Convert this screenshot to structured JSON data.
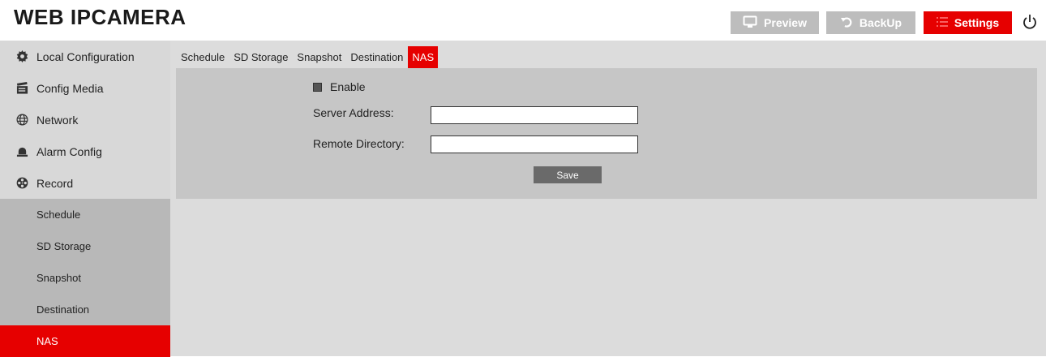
{
  "header": {
    "logo": "WEB IPCAMERA",
    "preview_label": "Preview",
    "backup_label": "BackUp",
    "settings_label": "Settings",
    "preview_icon": "monitor-icon",
    "backup_icon": "undo-icon",
    "settings_icon": "list-icon",
    "power_icon": "power-icon"
  },
  "sidebar": {
    "items": [
      {
        "label": "Local Configuration",
        "icon": "gear-icon"
      },
      {
        "label": "Config Media",
        "icon": "clapperboard-icon"
      },
      {
        "label": "Network",
        "icon": "network-globe-icon"
      },
      {
        "label": "Alarm Config",
        "icon": "alarm-bell-icon"
      },
      {
        "label": "Record",
        "icon": "film-reel-icon"
      }
    ],
    "subitems": [
      {
        "label": "Schedule"
      },
      {
        "label": "SD Storage"
      },
      {
        "label": "Snapshot"
      },
      {
        "label": "Destination"
      },
      {
        "label": "NAS",
        "active": true
      }
    ]
  },
  "tabs": [
    {
      "label": "Schedule"
    },
    {
      "label": "SD Storage"
    },
    {
      "label": "Snapshot"
    },
    {
      "label": "Destination"
    },
    {
      "label": "NAS",
      "active": true
    }
  ],
  "form": {
    "enable_label": "Enable",
    "server_address_label": "Server Address:",
    "server_address_value": "",
    "remote_directory_label": "Remote Directory:",
    "remote_directory_value": "",
    "save_label": "Save"
  },
  "colors": {
    "accent": "#e60000",
    "header_button": "#bdbdbd",
    "sidebar_bg": "#d8d8d8",
    "submenu_bg": "#b8b8b8",
    "panel_bg": "#c6c6c6",
    "main_bg": "#dcdcdc"
  }
}
